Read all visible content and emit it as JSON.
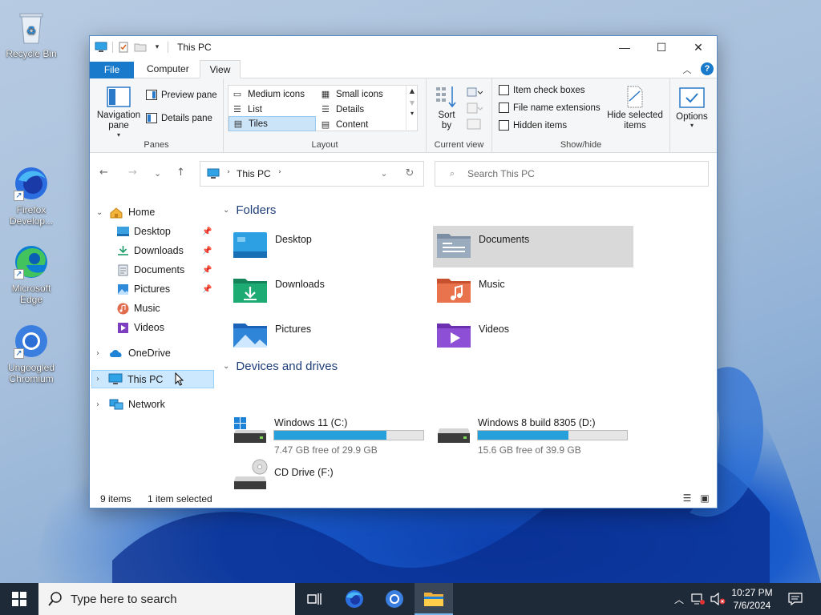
{
  "desktop": {
    "icons": [
      {
        "label": "Recycle Bin",
        "icon": "recycle-bin-icon"
      },
      {
        "label": "Firefox Develop...",
        "icon": "firefox-developer-icon"
      },
      {
        "label": "Microsoft Edge",
        "icon": "edge-icon"
      },
      {
        "label": "Ungoogled Chromium",
        "icon": "chromium-icon"
      }
    ]
  },
  "window": {
    "title": "This PC",
    "tabs": {
      "file": "File",
      "computer": "Computer",
      "view": "View"
    },
    "ribbon": {
      "panes": {
        "navigation_pane": "Navigation pane",
        "preview_pane": "Preview pane",
        "details_pane": "Details pane",
        "label": "Panes"
      },
      "layout": {
        "items": [
          "Medium icons",
          "Small icons",
          "List",
          "Details",
          "Tiles",
          "Content"
        ],
        "selected": "Tiles",
        "label": "Layout"
      },
      "current_view": {
        "sort_by": "Sort by",
        "label": "Current view"
      },
      "show_hide": {
        "item_check_boxes": "Item check boxes",
        "file_name_extensions": "File name extensions",
        "hidden_items": "Hidden items",
        "hide_selected_items": "Hide selected items",
        "label": "Show/hide"
      },
      "options": "Options"
    },
    "address": {
      "location": "This PC",
      "search_placeholder": "Search This PC"
    },
    "nav_pane": {
      "home": "Home",
      "quick_access": [
        "Desktop",
        "Downloads",
        "Documents",
        "Pictures",
        "Music",
        "Videos"
      ],
      "onedrive": "OneDrive",
      "this_pc": "This PC",
      "network": "Network"
    },
    "content": {
      "folders_header": "Folders",
      "folders": [
        "Desktop",
        "Documents",
        "Downloads",
        "Music",
        "Pictures",
        "Videos"
      ],
      "selected_folder": "Documents",
      "devices_header": "Devices and drives",
      "drives": [
        {
          "name": "Windows 11 (C:)",
          "free_text": "7.47 GB free of 29.9 GB",
          "used_fraction": 0.75
        },
        {
          "name": "Windows 8 build 8305 (D:)",
          "free_text": "15.6 GB free of 39.9 GB",
          "used_fraction": 0.61
        },
        {
          "name": "CD Drive (F:)"
        }
      ]
    },
    "status": {
      "items": "9 items",
      "selected": "1 item selected"
    }
  },
  "taskbar": {
    "search_placeholder": "Type here to search",
    "time": "10:27 PM",
    "date": "7/6/2024"
  },
  "colors": {
    "accent": "#1979ca",
    "drive_bar": "#26a0da",
    "selection": "#cce8ff",
    "taskbar": "#1f2a38"
  }
}
